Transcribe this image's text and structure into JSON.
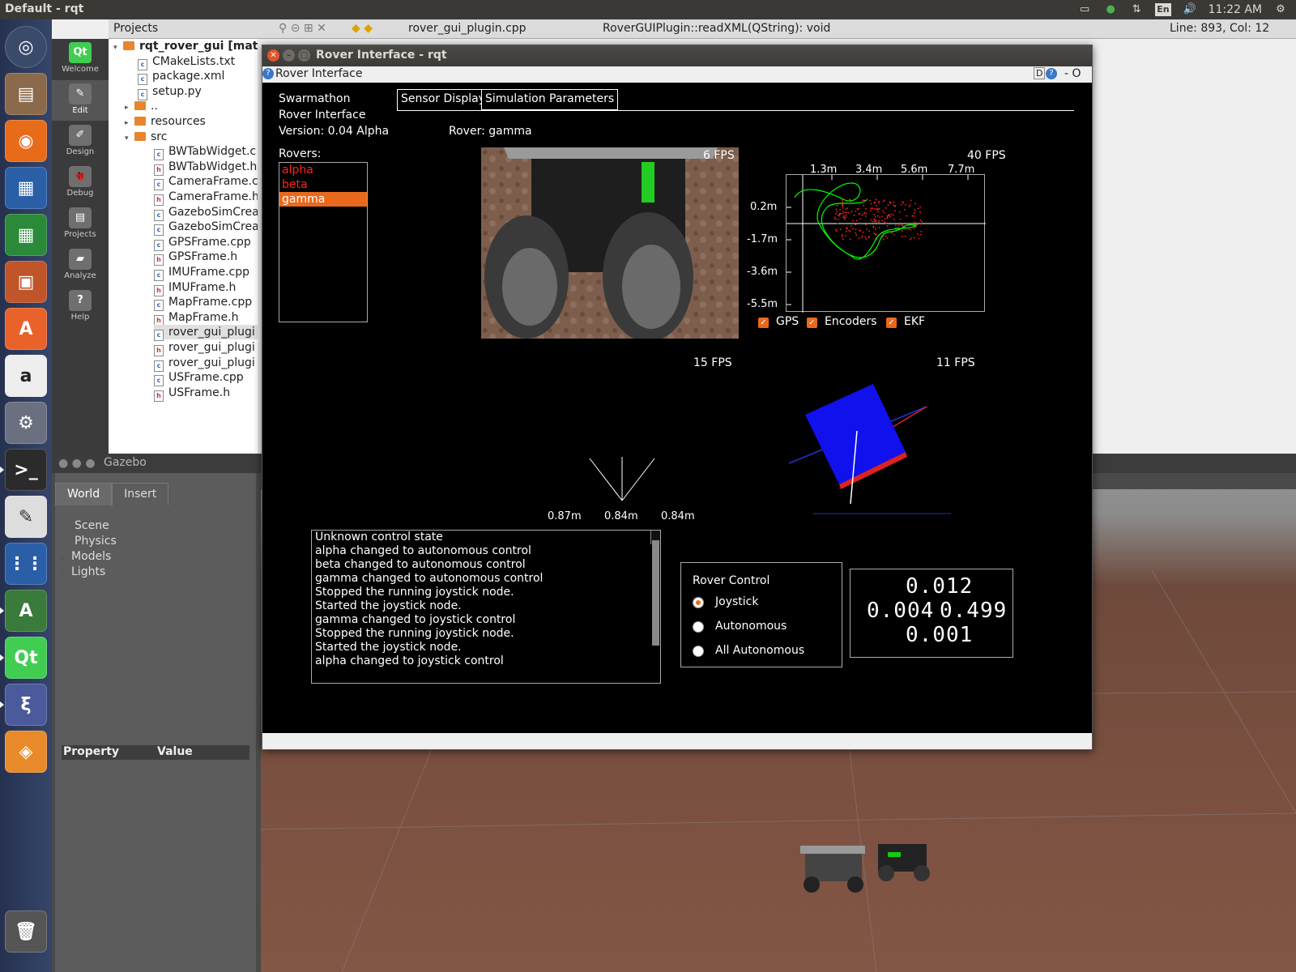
{
  "topbar": {
    "title": "Default - rqt",
    "lang": "En",
    "clock": "11:22 AM"
  },
  "qtcreator": {
    "modes": [
      {
        "label": "Welcome",
        "icon": "Qt"
      },
      {
        "label": "Edit",
        "icon": "✎"
      },
      {
        "label": "Design",
        "icon": "✐"
      },
      {
        "label": "Debug",
        "icon": "🐞"
      },
      {
        "label": "Projects",
        "icon": "▤"
      },
      {
        "label": "Analyze",
        "icon": "▰"
      },
      {
        "label": "Help",
        "icon": "?"
      }
    ],
    "header": {
      "projects": "Projects",
      "file_combo": "rover_gui_plugin.cpp",
      "function_combo": "RoverGUIPlugin::readXML(QString): void",
      "position": "Line: 893, Col: 12"
    },
    "tree": {
      "root": "rqt_rover_gui [matt",
      "items": [
        "CMakeLists.txt",
        "package.xml",
        "setup.py",
        "..",
        "resources",
        "src",
        "BWTabWidget.c",
        "BWTabWidget.h",
        "CameraFrame.c",
        "CameraFrame.h",
        "GazeboSimCrea",
        "GazeboSimCrea",
        "GPSFrame.cpp",
        "GPSFrame.h",
        "IMUFrame.cpp",
        "IMUFrame.h",
        "MapFrame.cpp",
        "MapFrame.h",
        "rover_gui_plugi",
        "rover_gui_plugi",
        "rover_gui_plugi",
        "USFrame.cpp",
        "USFrame.h"
      ]
    }
  },
  "gazebo": {
    "title": "Gazebo",
    "tabs": [
      "World",
      "Insert"
    ],
    "tree": [
      "Scene",
      "Physics",
      "Models",
      "Lights"
    ],
    "prop_header": {
      "property": "Property",
      "value": "Value"
    }
  },
  "rqt": {
    "window_title": "Rover Interface - rqt",
    "subtitle": "Rover Interface",
    "subtitle_right": "D",
    "subtitle_close": "- O",
    "app_name_line1": "Swarmathon",
    "app_name_line2": "Rover Interface",
    "version": "Version:  0.04 Alpha",
    "rover_label": "Rover: gamma",
    "rovers_header": "Rovers:",
    "rovers": [
      {
        "name": "alpha",
        "color": "#ff2020",
        "selected": false
      },
      {
        "name": "beta",
        "color": "#ff2020",
        "selected": false
      },
      {
        "name": "gamma",
        "color": "#ffffff",
        "selected": true
      }
    ],
    "tabs": [
      "Sensor Display",
      "Simulation Parameters"
    ],
    "camera_fps": "6 FPS",
    "map_fps": "40 FPS",
    "map_x_ticks": [
      "1.3m",
      "3.4m",
      "5.6m",
      "7.7m"
    ],
    "map_y_ticks": [
      "0.2m",
      "-1.7m",
      "-3.6m",
      "-5.5m"
    ],
    "map_legend": [
      "GPS",
      "Encoders",
      "EKF"
    ],
    "us_fps": "15 FPS",
    "imu_fps": "11 FPS",
    "us_ranges": [
      "0.87m",
      "0.84m",
      "0.84m"
    ],
    "log": [
      "Unknown control state",
      "alpha changed to autonomous control",
      "beta changed to autonomous control",
      "gamma changed to autonomous control",
      "Stopped the running joystick node.",
      "Started the joystick node.",
      "gamma changed to joystick control",
      "Stopped the running joystick node.",
      "Started the joystick node.",
      "alpha changed to joystick control"
    ],
    "control": {
      "title": "Rover Control",
      "options": [
        {
          "label": "Joystick",
          "selected": true
        },
        {
          "label": "Autonomous",
          "selected": false
        },
        {
          "label": "All Autonomous",
          "selected": false
        }
      ]
    },
    "imu": {
      "line1": "0.012",
      "line2a": "0.004",
      "line2b": "0.499",
      "line3": "0.001"
    }
  },
  "colors": {
    "accent": "#e9691c",
    "gps_track": "#00ff00",
    "ekf_points": "#ff2020"
  }
}
